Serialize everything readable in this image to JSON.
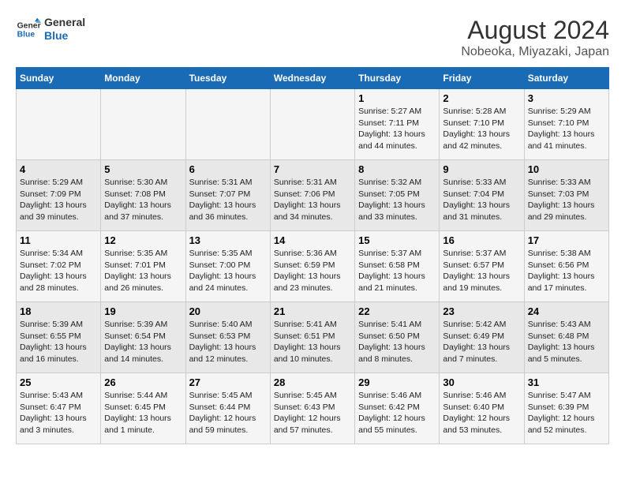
{
  "header": {
    "logo_line1": "General",
    "logo_line2": "Blue",
    "title": "August 2024",
    "subtitle": "Nobeoka, Miyazaki, Japan"
  },
  "days_of_week": [
    "Sunday",
    "Monday",
    "Tuesday",
    "Wednesday",
    "Thursday",
    "Friday",
    "Saturday"
  ],
  "weeks": [
    [
      {
        "day": "",
        "content": ""
      },
      {
        "day": "",
        "content": ""
      },
      {
        "day": "",
        "content": ""
      },
      {
        "day": "",
        "content": ""
      },
      {
        "day": "1",
        "content": "Sunrise: 5:27 AM\nSunset: 7:11 PM\nDaylight: 13 hours\nand 44 minutes."
      },
      {
        "day": "2",
        "content": "Sunrise: 5:28 AM\nSunset: 7:10 PM\nDaylight: 13 hours\nand 42 minutes."
      },
      {
        "day": "3",
        "content": "Sunrise: 5:29 AM\nSunset: 7:10 PM\nDaylight: 13 hours\nand 41 minutes."
      }
    ],
    [
      {
        "day": "4",
        "content": "Sunrise: 5:29 AM\nSunset: 7:09 PM\nDaylight: 13 hours\nand 39 minutes."
      },
      {
        "day": "5",
        "content": "Sunrise: 5:30 AM\nSunset: 7:08 PM\nDaylight: 13 hours\nand 37 minutes."
      },
      {
        "day": "6",
        "content": "Sunrise: 5:31 AM\nSunset: 7:07 PM\nDaylight: 13 hours\nand 36 minutes."
      },
      {
        "day": "7",
        "content": "Sunrise: 5:31 AM\nSunset: 7:06 PM\nDaylight: 13 hours\nand 34 minutes."
      },
      {
        "day": "8",
        "content": "Sunrise: 5:32 AM\nSunset: 7:05 PM\nDaylight: 13 hours\nand 33 minutes."
      },
      {
        "day": "9",
        "content": "Sunrise: 5:33 AM\nSunset: 7:04 PM\nDaylight: 13 hours\nand 31 minutes."
      },
      {
        "day": "10",
        "content": "Sunrise: 5:33 AM\nSunset: 7:03 PM\nDaylight: 13 hours\nand 29 minutes."
      }
    ],
    [
      {
        "day": "11",
        "content": "Sunrise: 5:34 AM\nSunset: 7:02 PM\nDaylight: 13 hours\nand 28 minutes."
      },
      {
        "day": "12",
        "content": "Sunrise: 5:35 AM\nSunset: 7:01 PM\nDaylight: 13 hours\nand 26 minutes."
      },
      {
        "day": "13",
        "content": "Sunrise: 5:35 AM\nSunset: 7:00 PM\nDaylight: 13 hours\nand 24 minutes."
      },
      {
        "day": "14",
        "content": "Sunrise: 5:36 AM\nSunset: 6:59 PM\nDaylight: 13 hours\nand 23 minutes."
      },
      {
        "day": "15",
        "content": "Sunrise: 5:37 AM\nSunset: 6:58 PM\nDaylight: 13 hours\nand 21 minutes."
      },
      {
        "day": "16",
        "content": "Sunrise: 5:37 AM\nSunset: 6:57 PM\nDaylight: 13 hours\nand 19 minutes."
      },
      {
        "day": "17",
        "content": "Sunrise: 5:38 AM\nSunset: 6:56 PM\nDaylight: 13 hours\nand 17 minutes."
      }
    ],
    [
      {
        "day": "18",
        "content": "Sunrise: 5:39 AM\nSunset: 6:55 PM\nDaylight: 13 hours\nand 16 minutes."
      },
      {
        "day": "19",
        "content": "Sunrise: 5:39 AM\nSunset: 6:54 PM\nDaylight: 13 hours\nand 14 minutes."
      },
      {
        "day": "20",
        "content": "Sunrise: 5:40 AM\nSunset: 6:53 PM\nDaylight: 13 hours\nand 12 minutes."
      },
      {
        "day": "21",
        "content": "Sunrise: 5:41 AM\nSunset: 6:51 PM\nDaylight: 13 hours\nand 10 minutes."
      },
      {
        "day": "22",
        "content": "Sunrise: 5:41 AM\nSunset: 6:50 PM\nDaylight: 13 hours\nand 8 minutes."
      },
      {
        "day": "23",
        "content": "Sunrise: 5:42 AM\nSunset: 6:49 PM\nDaylight: 13 hours\nand 7 minutes."
      },
      {
        "day": "24",
        "content": "Sunrise: 5:43 AM\nSunset: 6:48 PM\nDaylight: 13 hours\nand 5 minutes."
      }
    ],
    [
      {
        "day": "25",
        "content": "Sunrise: 5:43 AM\nSunset: 6:47 PM\nDaylight: 13 hours\nand 3 minutes."
      },
      {
        "day": "26",
        "content": "Sunrise: 5:44 AM\nSunset: 6:45 PM\nDaylight: 13 hours\nand 1 minute."
      },
      {
        "day": "27",
        "content": "Sunrise: 5:45 AM\nSunset: 6:44 PM\nDaylight: 12 hours\nand 59 minutes."
      },
      {
        "day": "28",
        "content": "Sunrise: 5:45 AM\nSunset: 6:43 PM\nDaylight: 12 hours\nand 57 minutes."
      },
      {
        "day": "29",
        "content": "Sunrise: 5:46 AM\nSunset: 6:42 PM\nDaylight: 12 hours\nand 55 minutes."
      },
      {
        "day": "30",
        "content": "Sunrise: 5:46 AM\nSunset: 6:40 PM\nDaylight: 12 hours\nand 53 minutes."
      },
      {
        "day": "31",
        "content": "Sunrise: 5:47 AM\nSunset: 6:39 PM\nDaylight: 12 hours\nand 52 minutes."
      }
    ]
  ]
}
